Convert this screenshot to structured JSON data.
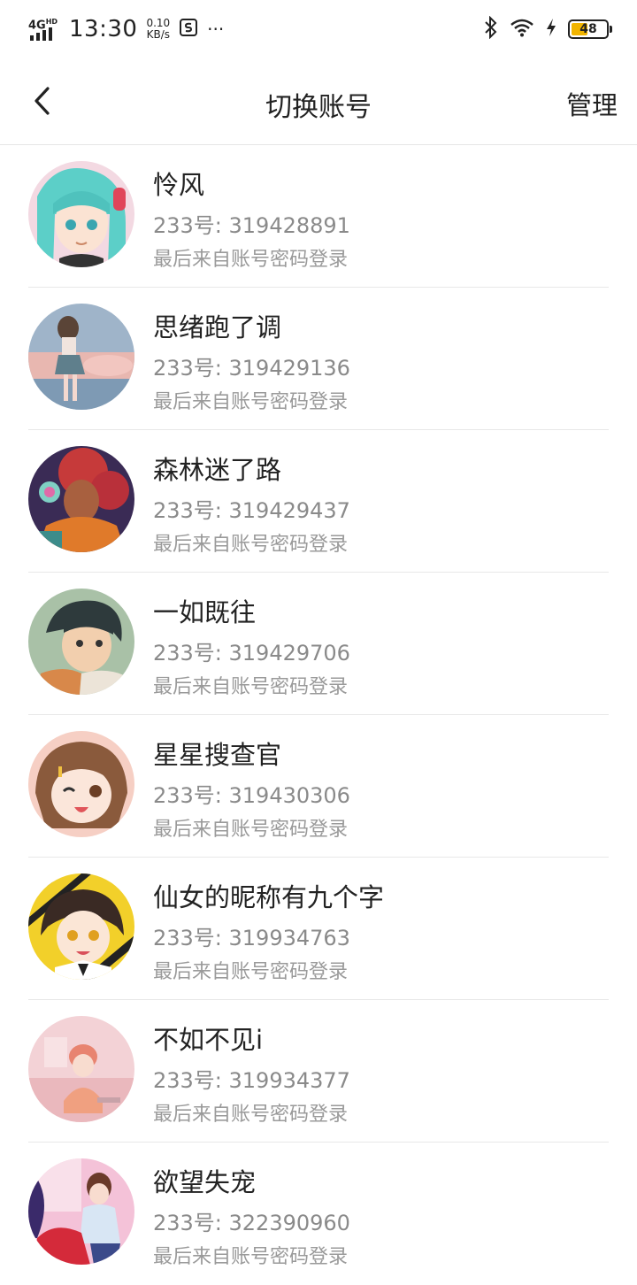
{
  "status_bar": {
    "network": "4G",
    "network_sup": "HD",
    "time": "13:30",
    "speed_value": "0.10",
    "speed_unit": "KB/s",
    "more": "···",
    "battery_level": "48",
    "battery_fraction": 0.48,
    "battery_color": "#f1b400"
  },
  "header": {
    "title": "切换账号",
    "manage_label": "管理"
  },
  "accounts": [
    {
      "name": "怜风",
      "uid": "233号: 319428891",
      "login": "最后来自账号密码登录"
    },
    {
      "name": "思绪跑了调",
      "uid": "233号: 319429136",
      "login": "最后来自账号密码登录"
    },
    {
      "name": "森林迷了路",
      "uid": "233号: 319429437",
      "login": "最后来自账号密码登录"
    },
    {
      "name": "一如既往",
      "uid": "233号: 319429706",
      "login": "最后来自账号密码登录"
    },
    {
      "name": "星星搜查官",
      "uid": "233号: 319430306",
      "login": "最后来自账号密码登录"
    },
    {
      "name": "仙女的昵称有九个字",
      "uid": "233号: 319934763",
      "login": "最后来自账号密码登录"
    },
    {
      "name": "不如不见i",
      "uid": "233号: 319934377",
      "login": "最后来自账号密码登录"
    },
    {
      "name": "欲望失宠",
      "uid": "233号: 322390960",
      "login": "最后来自账号密码登录"
    }
  ]
}
